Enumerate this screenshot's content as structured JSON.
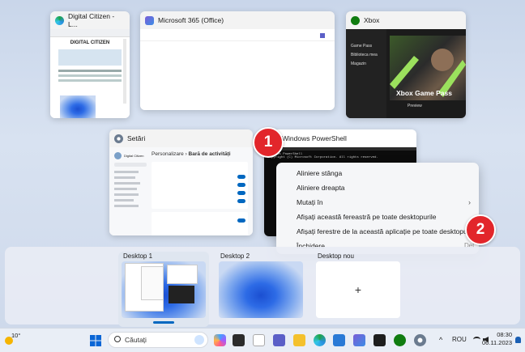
{
  "windows": {
    "digital_citizen": {
      "title": "Digital Citizen - L...",
      "site_banner": "DIGITAL CITIZEN"
    },
    "office": {
      "title": "Microsoft 365 (Office)"
    },
    "xbox": {
      "title": "Xbox",
      "promo": "Xbox Game Pass",
      "button": "Preview",
      "nav": [
        "Game Pass",
        "Biblioteca mea",
        "Magazin"
      ]
    },
    "settings": {
      "title": "Setări",
      "breadcrumb_parent": "Personalizare",
      "breadcrumb_current": "Bară de activități",
      "user": "Digital Citizen"
    },
    "powershell": {
      "title": "Windows PowerShell",
      "line1": "Windows PowerShell",
      "line2": "Copyright (C) Microsoft Corporation. All rights reserved."
    }
  },
  "badges": [
    "1",
    "2"
  ],
  "context_menu": {
    "items": [
      {
        "label": "Aliniere stânga"
      },
      {
        "label": "Aliniere dreapta"
      },
      {
        "label": "Mutați în",
        "submenu": "›"
      },
      {
        "label": "Afișați această fereastră pe toate desktopurile"
      },
      {
        "label": "Afișați ferestre de la această aplicație pe toate desktopurile"
      },
      {
        "label": "Închidere",
        "shortcut": "Del"
      }
    ]
  },
  "desktops": [
    {
      "label": "Desktop 1"
    },
    {
      "label": "Desktop 2"
    },
    {
      "label": "Desktop nou",
      "plus": "+"
    }
  ],
  "taskbar": {
    "weather_temp": "10°",
    "search_placeholder": "Căutați",
    "language": "ROU",
    "time": "08:30",
    "date": "06.11.2023",
    "tray_chevron": "^"
  },
  "colors": {
    "badge": "#e2262b",
    "accent": "#0067c0"
  }
}
